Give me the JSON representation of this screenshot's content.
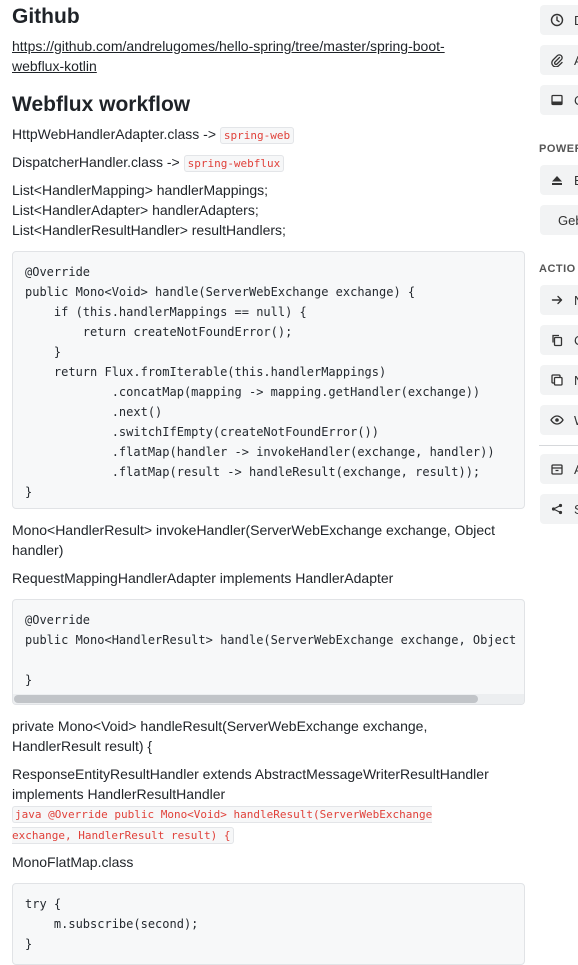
{
  "article": {
    "github_heading": "Github",
    "github_link": "https://github.com/andrelugomes/hello-spring/tree/master/spring-boot-webflux-kotlin",
    "workflow_heading": "Webflux workflow",
    "line1_text": "HttpWebHandlerAdapter.class ->",
    "line1_code": "spring-web",
    "line2_text": "DispatcherHandler.class ->",
    "line2_code": "spring-webflux",
    "list_lines": [
      "List<HandlerMapping> handlerMappings;",
      "List<HandlerAdapter> handlerAdapters;",
      "List<HandlerResultHandler> resultHandlers;"
    ],
    "code1": "@Override\npublic Mono<Void> handle(ServerWebExchange exchange) {\n    if (this.handlerMappings == null) {\n        return createNotFoundError();\n    }\n    return Flux.fromIterable(this.handlerMappings)\n            .concatMap(mapping -> mapping.getHandler(exchange))\n            .next()\n            .switchIfEmpty(createNotFoundError())\n            .flatMap(handler -> invokeHandler(exchange, handler))\n            .flatMap(result -> handleResult(exchange, result));\n}",
    "invoke_line": "Mono<HandlerResult> invokeHandler(ServerWebExchange exchange, Object handler)",
    "adapter_line": "RequestMappingHandlerAdapter implements HandlerAdapter",
    "code2": "@Override\npublic Mono<HandlerResult> handle(ServerWebExchange exchange, Object handler) {\n\n}",
    "handle_result_line": "private Mono<Void> handleResult(ServerWebExchange exchange, HandlerResult result) {",
    "response_line": "ResponseEntityResultHandler extends AbstractMessageWriterResultHandler implements HandlerResultHandler",
    "inline_java": "java @Override public Mono<Void> handleResult(ServerWebExchange exchange, HandlerResult result) {",
    "mono_flatmap_line": "MonoFlatMap.class",
    "code3": "try {\n    m.subscribe(second);\n}"
  },
  "sidebar": {
    "top_buttons": [
      {
        "label": "D",
        "icon": "clock-icon"
      },
      {
        "label": "A",
        "icon": "paperclip-icon"
      },
      {
        "label": "C",
        "icon": "display-icon"
      }
    ],
    "power_heading": "POWER",
    "power_buttons": [
      {
        "label": "B",
        "icon": "eject-icon"
      }
    ],
    "power_plain_button": "Geb",
    "actions_heading": "ACTIO",
    "action_buttons": [
      {
        "label": "N",
        "icon": "arrow-right-icon"
      },
      {
        "label": "C",
        "icon": "copy-icon"
      },
      {
        "label": "N",
        "icon": "layers-icon"
      },
      {
        "label": "W",
        "icon": "eye-icon"
      }
    ],
    "bottom_buttons": [
      {
        "label": "A",
        "icon": "archive-icon"
      },
      {
        "label": "S",
        "icon": "share-icon"
      }
    ]
  }
}
